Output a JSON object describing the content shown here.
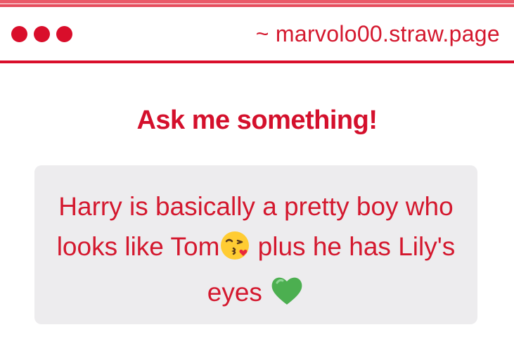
{
  "window": {
    "url": "~ marvolo00.straw.page",
    "dots": [
      "window-dot",
      "window-dot",
      "window-dot"
    ]
  },
  "page": {
    "heading": "Ask me something!",
    "question": {
      "part1": "Harry is basically a pretty boy who looks like Tom",
      "emoji1": "😘",
      "part2": " plus he has Lily's eyes ",
      "emoji2": "💚"
    }
  },
  "colors": {
    "accent": "#d90e2b",
    "text": "#d4182e",
    "card_bg": "#edecee",
    "emoji_kiss": "#ffcc33",
    "emoji_heart": "#4caf50"
  }
}
